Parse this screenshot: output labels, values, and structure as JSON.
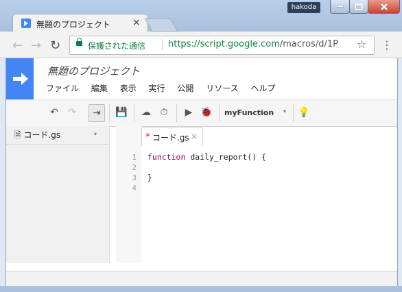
{
  "window": {
    "user": "hakoda"
  },
  "browser": {
    "tab_title": "無題のプロジェクト",
    "tab_close": "×",
    "security_text": "保護された通信",
    "url_host": "https://script.google.com",
    "url_path": "/macros/d/1P",
    "back": "←",
    "forward": "→",
    "reload": "↻",
    "star": "☆",
    "menu": "⋮"
  },
  "app": {
    "project_name": "無題のプロジェクト",
    "menu": [
      "ファイル",
      "編集",
      "表示",
      "実行",
      "公開",
      "リソース",
      "ヘルプ"
    ],
    "toolbar": {
      "undo": "↶",
      "redo": "↷",
      "indent": "⇥",
      "save": "💾",
      "cloud": "☁",
      "clock": "⏱",
      "run": "▶",
      "debug": "🐞",
      "function": "myFunction",
      "dropdown": "▾",
      "bulb": "💡"
    },
    "sidebar": {
      "file": "コード.gs",
      "file_arrow": "▾"
    },
    "editor": {
      "tab_star": "*",
      "tab_name": "コード.gs",
      "tab_close": "×",
      "line_numbers": [
        "1",
        "2",
        "3",
        "4"
      ],
      "keyword": "function",
      "line1_rest": " daily_report() {",
      "line3": "}"
    }
  }
}
